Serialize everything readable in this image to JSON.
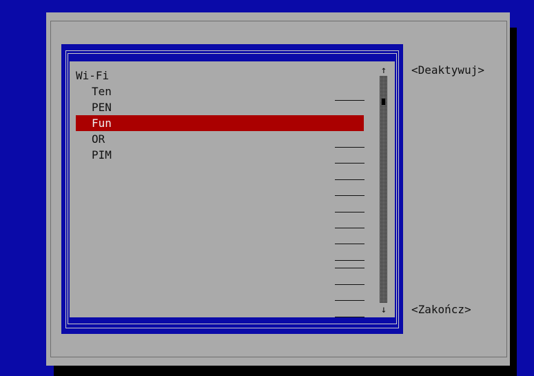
{
  "dialog": {
    "list": {
      "header": "Wi-Fi",
      "items": [
        {
          "label": "Ten",
          "selected": false
        },
        {
          "label": "PEN",
          "selected": false
        },
        {
          "label": "Fun",
          "selected": true
        },
        {
          "label": "OR",
          "selected": false
        },
        {
          "label": "PIM",
          "selected": false
        }
      ]
    },
    "scrollbar": {
      "up_arrow": "↑",
      "down_arrow": "↓"
    },
    "buttons": {
      "deactivate": "<Deaktywuj>",
      "quit": "<Zakończ>"
    }
  },
  "colors": {
    "background": "#0a0aa8",
    "dialog": "#aaaaaa",
    "selection": "#aa0000",
    "selected_text": "#f0f0f0"
  }
}
